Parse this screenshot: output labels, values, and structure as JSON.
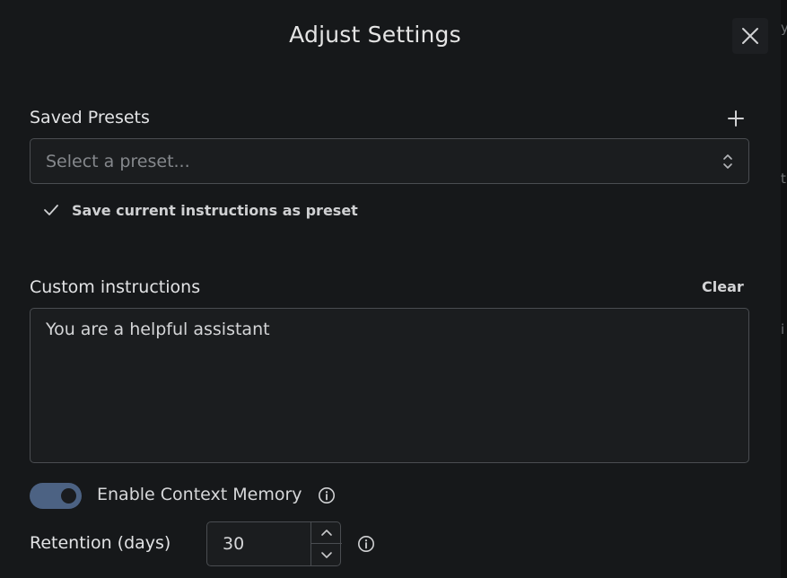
{
  "dialog": {
    "title": "Adjust Settings"
  },
  "presets": {
    "label": "Saved Presets",
    "select_placeholder": "Select a preset...",
    "save_label": "Save current instructions as preset"
  },
  "instructions": {
    "label": "Custom instructions",
    "clear_label": "Clear",
    "value": "You are a helpful assistant"
  },
  "memory": {
    "label": "Enable Context Memory",
    "enabled": true
  },
  "retention": {
    "label": "Retention (days)",
    "value": "30"
  },
  "background": {
    "snippets": [
      "y",
      "t",
      "i"
    ]
  },
  "colors": {
    "accent": "#4c6283",
    "background": "#16181a",
    "border": "#4a4d51"
  },
  "icons": {
    "close": "close-icon",
    "add": "plus-icon",
    "select": "chevron-up-down-icon",
    "check": "check-icon",
    "info": "info-icon",
    "step_up": "chevron-up-icon",
    "step_down": "chevron-down-icon"
  }
}
